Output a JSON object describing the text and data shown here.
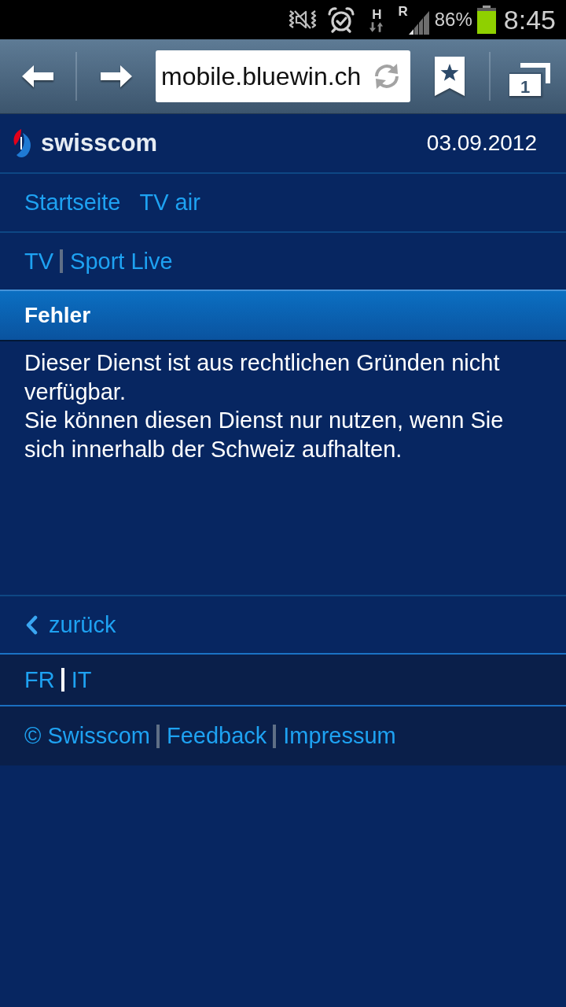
{
  "status_bar": {
    "network_type": "H",
    "roaming": "R",
    "battery": "86%",
    "time": "8:45"
  },
  "browser_toolbar": {
    "url": "mobile.bluewin.ch",
    "tab_count": "1"
  },
  "header": {
    "logo": "swisscom",
    "date": "03.09.2012"
  },
  "nav_links": [
    {
      "label": "Startseite"
    },
    {
      "label": "TV air"
    }
  ],
  "breadcrumb": [
    {
      "label": "TV"
    },
    {
      "label": "Sport Live"
    }
  ],
  "section": {
    "title": "Fehler",
    "paragraphs": [
      "Dieser Dienst ist aus rechtlichen Gründen nicht verfügbar.",
      "Sie können diesen Dienst nur nutzen, wenn Sie sich innerhalb der Schweiz aufhalten."
    ]
  },
  "back_link": {
    "label": "zurück"
  },
  "language_links": [
    {
      "label": "FR"
    },
    {
      "label": "IT"
    }
  ],
  "footer_links": [
    {
      "label": "© Swisscom"
    },
    {
      "label": "Feedback"
    },
    {
      "label": "Impressum"
    }
  ]
}
